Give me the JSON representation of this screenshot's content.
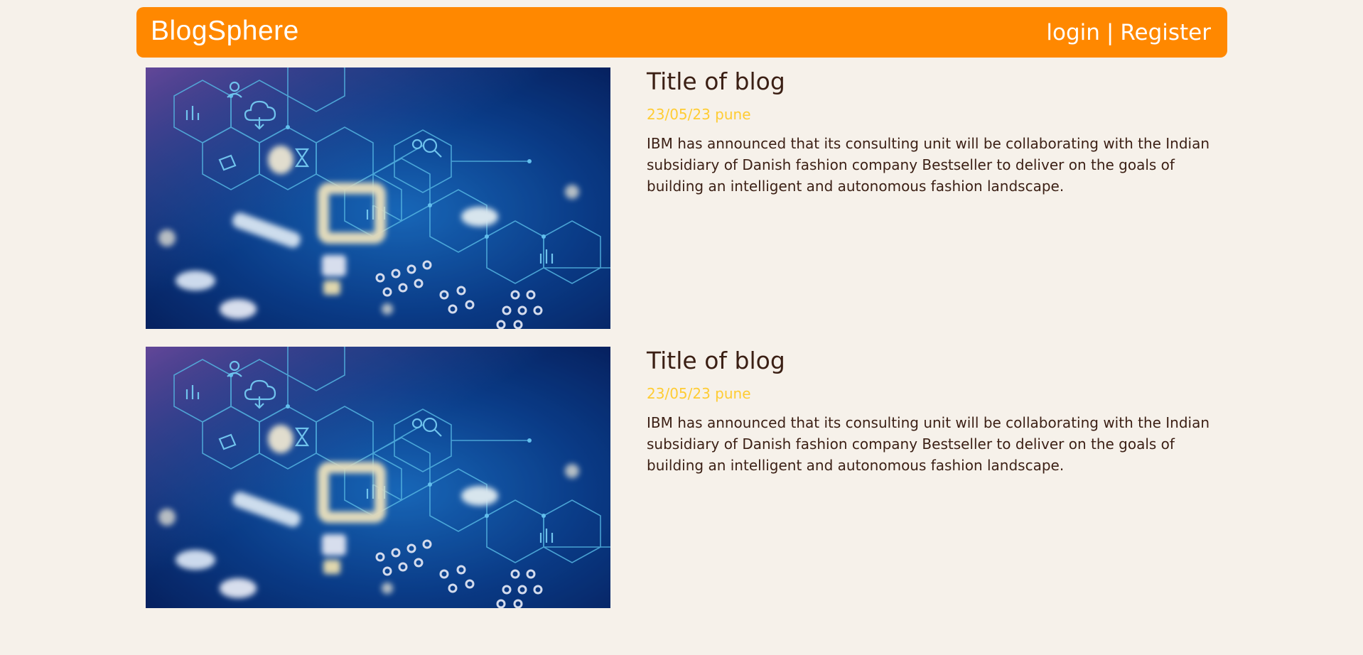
{
  "header": {
    "brand": "BlogSphere",
    "login_label": "login",
    "separator": "|",
    "register_label": "Register"
  },
  "posts": [
    {
      "title": "Title of blog",
      "meta": "23/05/23 pune",
      "excerpt": "IBM has announced that its consulting unit will be collaborating with the Indian subsidiary of Danish fashion company Bestseller to deliver on the goals of building an intelligent and autonomous fashion landscape."
    },
    {
      "title": "Title of blog",
      "meta": "23/05/23 pune",
      "excerpt": "IBM has announced that its consulting unit will be collaborating with the Indian subsidiary of Danish fashion company Bestseller to deliver on the goals of building an intelligent and autonomous fashion landscape."
    }
  ],
  "colors": {
    "navbar": "#ff8800",
    "background": "#f6f1ea",
    "title": "#3b1f14",
    "meta": "#ffcc33"
  }
}
